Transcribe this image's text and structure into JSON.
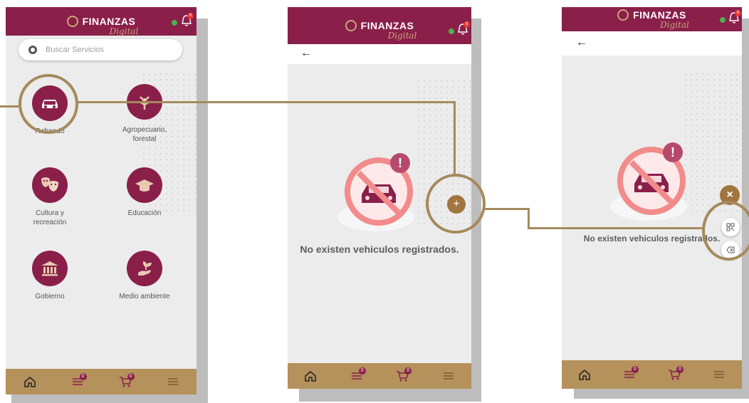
{
  "brand": {
    "name": "FINANZAS",
    "script": "Digital"
  },
  "notification_count": "0",
  "search": {
    "placeholder": "Buscar Servicios"
  },
  "services": [
    {
      "label": "Refrendo",
      "icon": "car-icon"
    },
    {
      "label": "Agropecuario, forestal",
      "icon": "plant-icon"
    },
    {
      "label": "Cultura y recreación",
      "icon": "theater-masks-icon"
    },
    {
      "label": "Educación",
      "icon": "graduation-cap-icon"
    },
    {
      "label": "Gobierno",
      "icon": "government-building-icon"
    },
    {
      "label": "Medio ambiente",
      "icon": "hand-plant-icon"
    }
  ],
  "vehicles": {
    "empty_message": "No existen vehiculos registrados."
  },
  "bottom_nav": {
    "items": [
      {
        "icon": "home-icon"
      },
      {
        "icon": "list-icon",
        "badge": "0"
      },
      {
        "icon": "cart-icon",
        "badge": "0"
      },
      {
        "icon": "menu-icon"
      }
    ]
  },
  "fab": {
    "add": "+",
    "close": "×"
  },
  "colors": {
    "primary": "#8a1f4a",
    "gold": "#b5915c",
    "callout": "#a58a5c"
  }
}
